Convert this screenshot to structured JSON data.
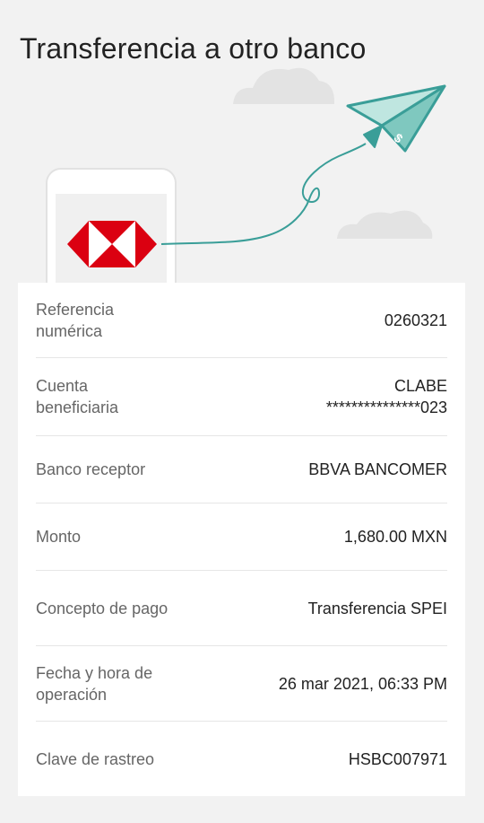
{
  "page": {
    "title": "Transferencia a otro banco"
  },
  "details": [
    {
      "label": "Referencia numérica",
      "value": "0260321"
    },
    {
      "label": "Cuenta beneficiaria",
      "value_line1": "CLABE",
      "value_line2": "***************023"
    },
    {
      "label": "Banco receptor",
      "value": "BBVA BANCOMER"
    },
    {
      "label": "Monto",
      "value": "1,680.00 MXN"
    },
    {
      "label": "Concepto de pago",
      "value": "Transferencia SPEI"
    },
    {
      "label": "Fecha y hora de operación",
      "value": "26 mar 2021, 06:33 PM"
    },
    {
      "label": "Clave de rastreo",
      "value": "HSBC007971"
    }
  ],
  "illustration": {
    "paper_plane_label": "$",
    "bank_logo": "hsbc-hexagon-logo",
    "colors": {
      "teal": "#3a9e98",
      "teal_light": "#7fc8bf",
      "hsbc_red": "#db0011",
      "cloud": "#e3e3e3"
    }
  }
}
